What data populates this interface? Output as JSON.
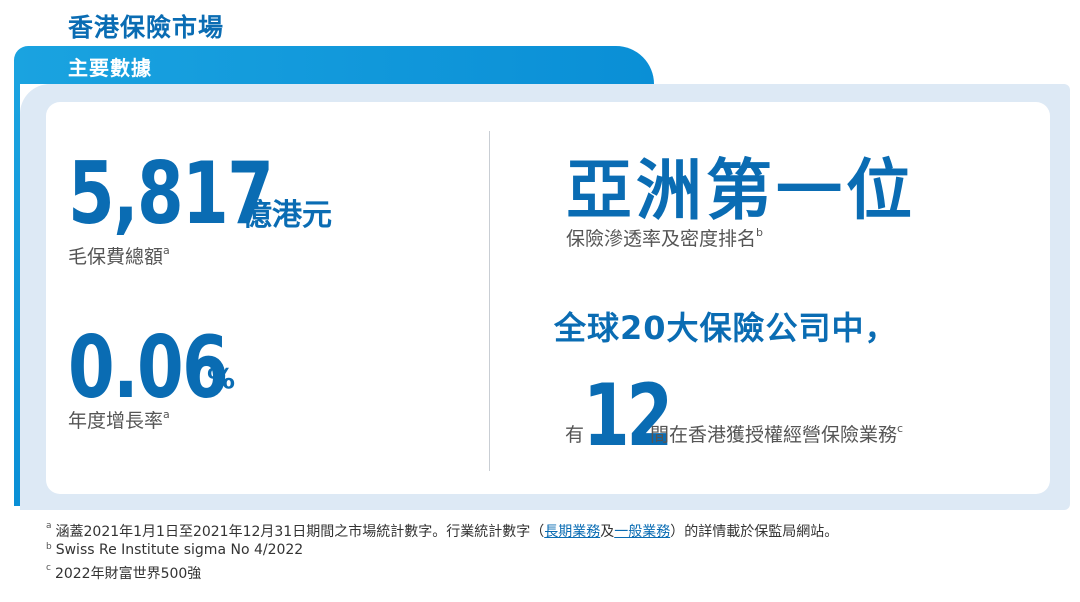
{
  "header": {
    "title": "香港保險市場",
    "tab_label": "主要數據"
  },
  "left": {
    "premium": {
      "value": "5,817",
      "unit": "億港元",
      "caption": "毛保費總額",
      "marker": "a"
    },
    "growth": {
      "value": "0.06",
      "unit": "%",
      "caption": "年度增長率",
      "marker": "a"
    }
  },
  "right": {
    "rank": {
      "headline": "亞洲第一位",
      "caption": "保險滲透率及密度排名",
      "marker": "b"
    },
    "global": {
      "line1": "全球20大保險公司中，",
      "prefix": "有",
      "number": "12",
      "suffix": "間在香港獲授權經營保險業務",
      "marker": "c"
    }
  },
  "footnotes": {
    "a": {
      "marker": "a",
      "text_before": "涵蓋2021年1月1日至2021年12月31日期間之市場統計數字。行業統計數字（",
      "link1": "長期業務",
      "mid": "及",
      "link2": "一般業務",
      "text_after": "）的詳情載於保監局網站。"
    },
    "b": {
      "marker": "b",
      "text": "Swiss Re Institute sigma No 4/2022"
    },
    "c": {
      "marker": "c",
      "text": "2022年財富世界500強"
    }
  },
  "colors": {
    "brand_blue": "#0a6cb3",
    "tab_blue": "#1aa3e0",
    "panel_bg": "#dde9f5"
  }
}
